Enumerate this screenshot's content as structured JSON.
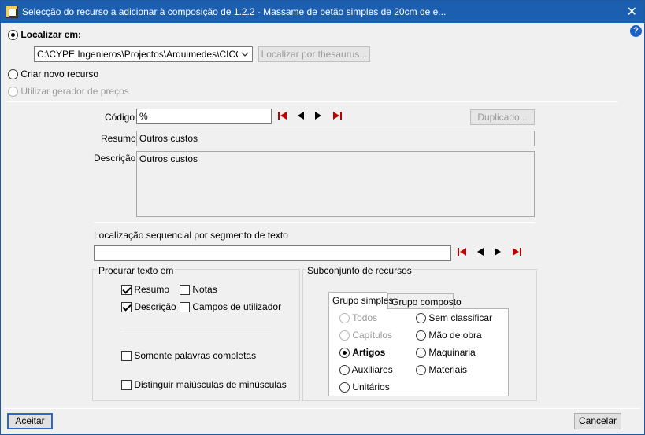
{
  "window": {
    "title": "Selecção do recurso a adicionar à composição de 1.2.2 - Massame de betão simples de 20cm de e...",
    "close_glyph": "✕",
    "help_glyph": "?"
  },
  "source": {
    "localizar_label": "Localizar em:",
    "path_value": "C:\\CYPE Ingenieros\\Projectos\\Arquimedes\\CICO CV",
    "thesaurus_button": "Localizar por thesaurus...",
    "criar_label": "Criar novo recurso",
    "gerador_label": "Utilizar gerador de preços"
  },
  "record": {
    "codigo_label": "Código",
    "codigo_value": "%",
    "duplicado_button": "Duplicado...",
    "resumo_label": "Resumo",
    "resumo_value": "Outros custos",
    "descricao_label": "Descrição",
    "descricao_value": "Outros custos"
  },
  "search": {
    "sequential_label": "Localização sequencial por segmento de texto",
    "sequential_value": ""
  },
  "procurar": {
    "title": "Procurar texto em",
    "resumo": "Resumo",
    "notas": "Notas",
    "descricao": "Descrição",
    "campos": "Campos de utilizador",
    "palavras": "Somente palavras completas",
    "maiusculas": "Distinguir maiúsculas de minúsculas"
  },
  "subconjunto": {
    "title": "Subconjunto de recursos",
    "tab_simples": "Grupo simples",
    "tab_composto": "Grupo composto",
    "todos": "Todos",
    "capitulos": "Capítulos",
    "artigos": "Artigos",
    "auxiliares": "Auxiliares",
    "unitarios": "Unitários",
    "sem_classificar": "Sem classificar",
    "mao_de_obra": "Mão de obra",
    "maquinaria": "Maquinaria",
    "materiais": "Materiais"
  },
  "footer": {
    "aceitar": "Aceitar",
    "cancelar": "Cancelar"
  },
  "colors": {
    "titlebar": "#1c5fb0",
    "nav_end_arrow": "#c00000",
    "focus": "#2f68c7"
  }
}
